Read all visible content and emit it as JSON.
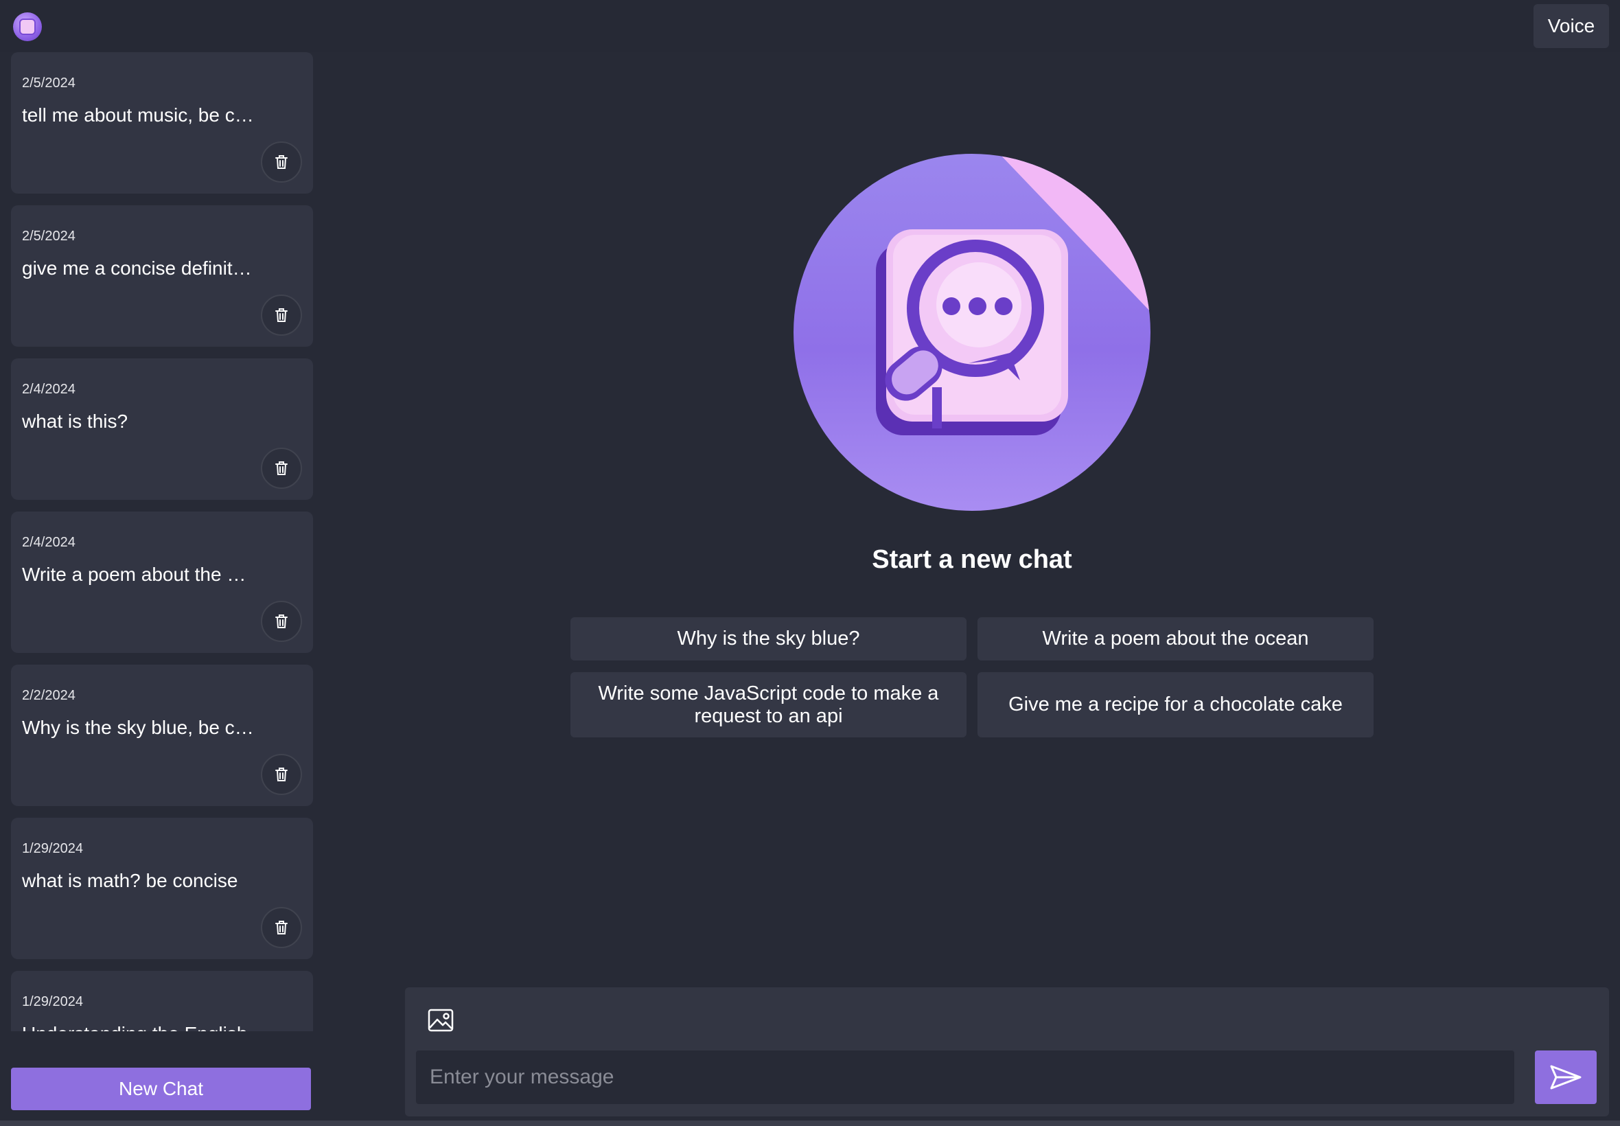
{
  "header": {
    "voice_label": "Voice"
  },
  "sidebar": {
    "chats": [
      {
        "date": "2/5/2024",
        "title": "tell me about music, be concise"
      },
      {
        "date": "2/5/2024",
        "title": "give me a concise definition"
      },
      {
        "date": "2/4/2024",
        "title": "what is this?"
      },
      {
        "date": "2/4/2024",
        "title": "Write a poem about the ocean"
      },
      {
        "date": "2/2/2024",
        "title": "Why is the sky blue, be concise"
      },
      {
        "date": "1/29/2024",
        "title": "what is math? be concise"
      },
      {
        "date": "1/29/2024",
        "title": "Understanding the English"
      }
    ],
    "new_chat_label": "New Chat"
  },
  "main": {
    "title": "Start a new chat",
    "suggestions": [
      "Why is the sky blue?",
      "Write a poem about the ocean",
      "Write some JavaScript code to make a request to an api",
      "Give me a recipe for a chocolate cake"
    ]
  },
  "composer": {
    "placeholder": "Enter your message",
    "value": ""
  },
  "icons": {
    "logo": "app-logo-icon",
    "delete": "trash-icon",
    "image": "image-upload-icon",
    "send": "send-icon"
  },
  "colors": {
    "background": "#272a36",
    "card": "#323543",
    "accent": "#8e6fdf"
  }
}
